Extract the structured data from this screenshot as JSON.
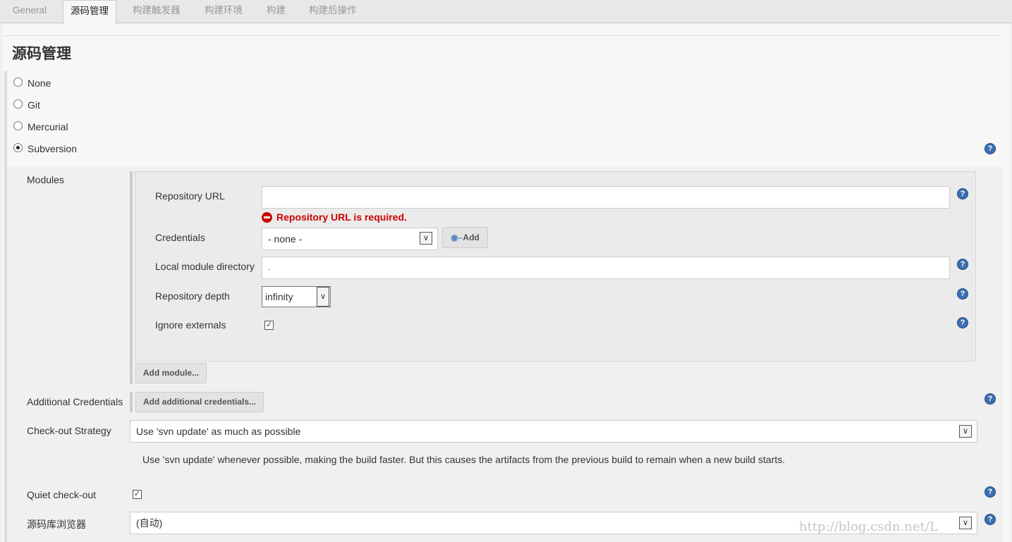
{
  "tabs": [
    "General",
    "源码管理",
    "构建触发器",
    "构建环境",
    "构建",
    "构建后操作"
  ],
  "active_tab": "源码管理",
  "section_title": "源码管理",
  "scm_options": [
    {
      "label": "None",
      "selected": false
    },
    {
      "label": "Git",
      "selected": false
    },
    {
      "label": "Mercurial",
      "selected": false
    },
    {
      "label": "Subversion",
      "selected": true
    }
  ],
  "modules": {
    "label": "Modules",
    "repository_url_label": "Repository URL",
    "repository_url_value": "",
    "error": "Repository URL is required.",
    "credentials_label": "Credentials",
    "credentials_value": "- none -",
    "add_button": "Add",
    "local_dir_label": "Local module directory",
    "local_dir_value": ".",
    "depth_label": "Repository depth",
    "depth_value": "infinity",
    "ignore_externals_label": "Ignore externals",
    "ignore_externals_checked": true,
    "add_module_button": "Add module..."
  },
  "additional_credentials_label": "Additional Credentials",
  "add_additional_credentials_button": "Add additional credentials...",
  "checkout_strategy_label": "Check-out Strategy",
  "checkout_strategy_value": "Use 'svn update' as much as possible",
  "checkout_strategy_description": "Use 'svn update' whenever possible, making the build faster. But this causes the artifacts from the previous build to remain when a new build starts.",
  "quiet_checkout_label": "Quiet check-out",
  "quiet_checkout_checked": true,
  "repo_browser_label": "源码库浏览器",
  "repo_browser_value": "(自动)",
  "watermark": "http://blog.csdn.net/L",
  "colors": {
    "error": "#cc0000",
    "help": "#3a6fb0"
  }
}
